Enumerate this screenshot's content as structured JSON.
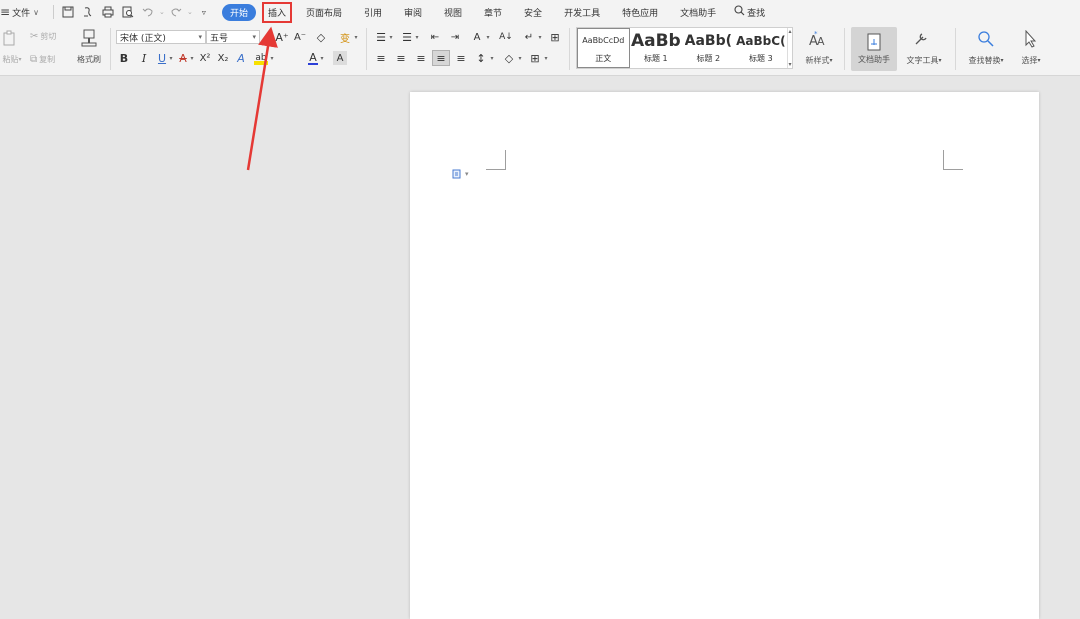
{
  "menubar": {
    "menu_icon": "≡",
    "file_label": "文件",
    "file_chevron": "∨",
    "quick_access": [
      {
        "name": "save-icon",
        "glyph": "🖫"
      },
      {
        "name": "export-pdf-icon",
        "glyph": "⎘"
      },
      {
        "name": "print-icon",
        "glyph": "⎙"
      },
      {
        "name": "print-preview-icon",
        "glyph": "🔍"
      },
      {
        "name": "undo-icon",
        "glyph": "↶"
      },
      {
        "name": "redo-icon",
        "glyph": "↷"
      },
      {
        "name": "customize-icon",
        "glyph": "▿"
      }
    ],
    "tabs": [
      "开始",
      "插入",
      "页面布局",
      "引用",
      "审阅",
      "视图",
      "章节",
      "安全",
      "开发工具",
      "特色应用",
      "文档助手"
    ],
    "search_label": "查找"
  },
  "ribbon": {
    "clipboard": {
      "paste": "粘贴",
      "cut": "剪切",
      "copy": "复制",
      "format_painter": "格式刷"
    },
    "font": {
      "family": "宋体 (正文)",
      "size": "五号",
      "grow": "A⁺",
      "shrink": "A⁻",
      "clear": "◇",
      "phonetic": "变",
      "bold": "B",
      "italic": "I",
      "underline": "U",
      "strikethrough": "A",
      "superscript": "X²",
      "subscript": "X₂",
      "text_effects": "A",
      "highlight": "ab",
      "font_color": "A",
      "char_shading": "A"
    },
    "paragraph": {
      "bullets": "☰",
      "numbering": "☰",
      "decrease_indent": "⇤",
      "increase_indent": "⇥",
      "chinese_layout": "A",
      "sort": "A↓",
      "show_marks": "↵",
      "table_border": "⊞",
      "align_left": "≡",
      "align_center": "≡",
      "align_right": "≡",
      "justify": "≡",
      "distributed": "≡",
      "line_spacing": "↕",
      "shading": "◇",
      "borders": "⊞"
    },
    "styles": {
      "items": [
        {
          "preview": "AaBbCcDd",
          "name": "正文"
        },
        {
          "preview": "AaBb",
          "name": "标题 1"
        },
        {
          "preview": "AaBb(",
          "name": "标题 2"
        },
        {
          "preview": "AaBbC(",
          "name": "标题 3"
        }
      ],
      "new_style": "新样式"
    },
    "tools": {
      "doc_assistant": "文档助手",
      "text_tools": "文字工具",
      "find_replace": "查找替换",
      "select": "选择"
    }
  },
  "annotation": {
    "color": "#e53935"
  }
}
